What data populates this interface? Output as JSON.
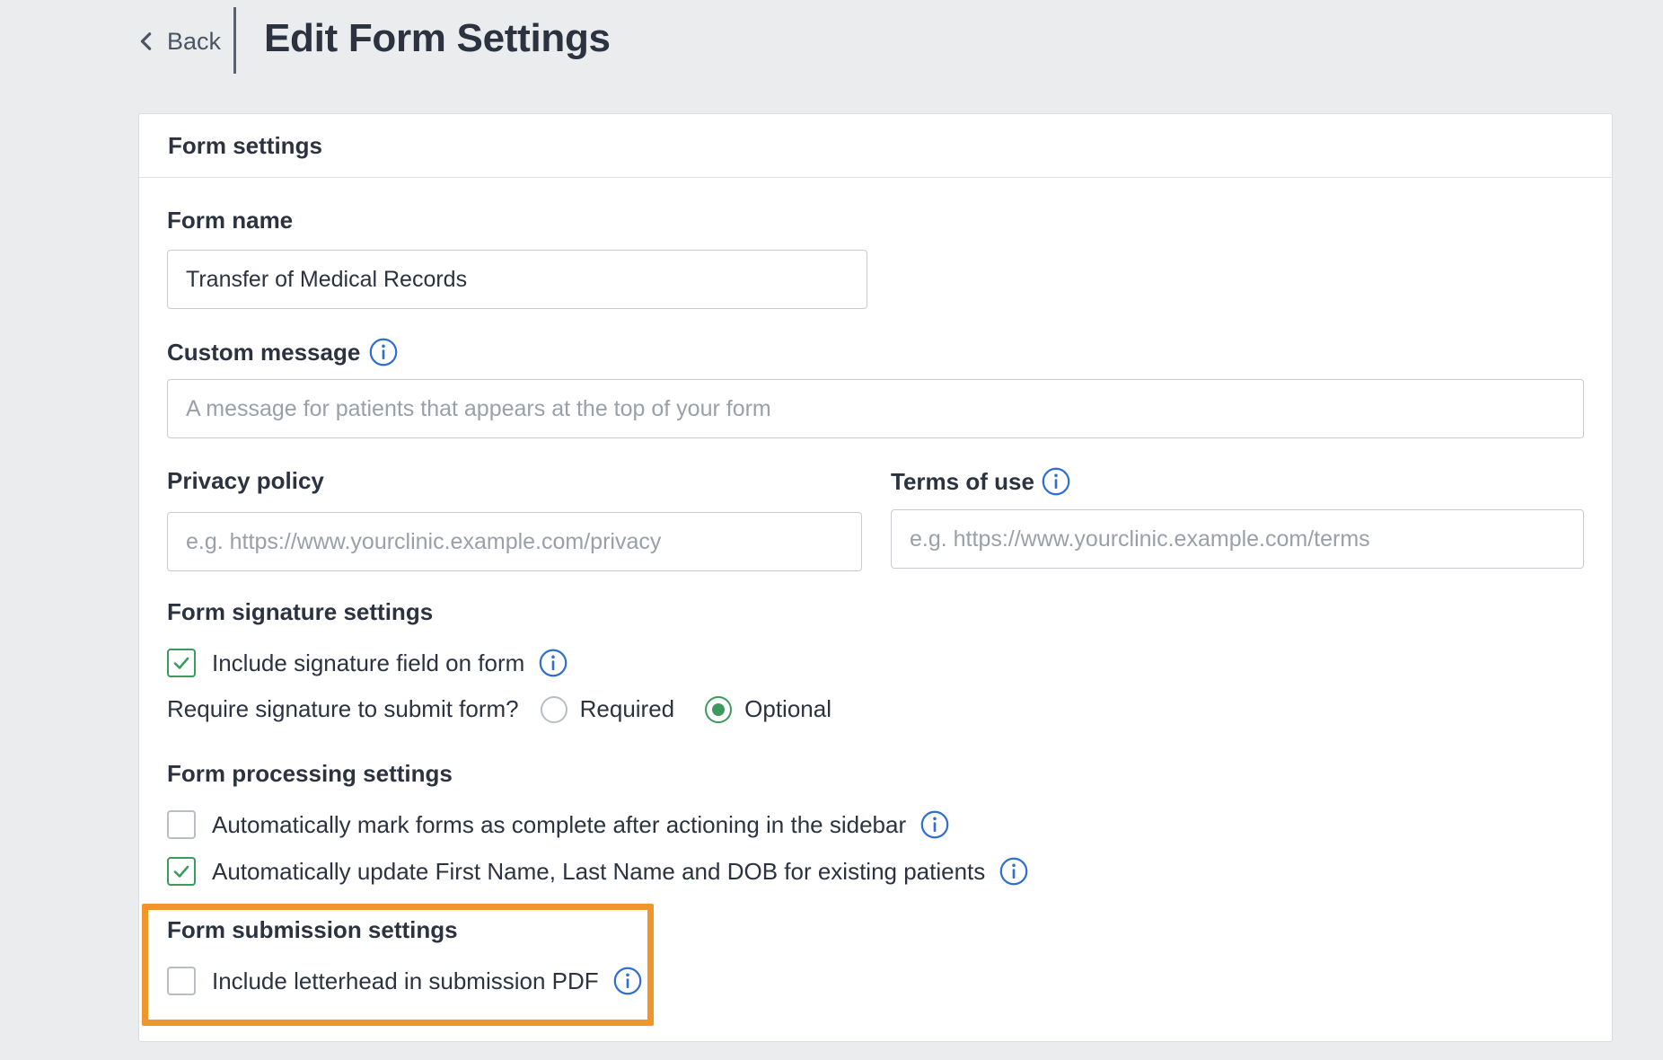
{
  "header": {
    "back_label": "Back",
    "title": "Edit Form Settings"
  },
  "card": {
    "title": "Form settings"
  },
  "form_name": {
    "label": "Form name",
    "value": "Transfer of Medical Records"
  },
  "custom_message": {
    "label": "Custom message",
    "placeholder": "A message for patients that appears at the top of your form"
  },
  "privacy_policy": {
    "label": "Privacy policy",
    "placeholder": "e.g. https://www.yourclinic.example.com/privacy"
  },
  "terms_of_use": {
    "label": "Terms of use",
    "placeholder": "e.g. https://www.yourclinic.example.com/terms"
  },
  "signature_settings": {
    "heading": "Form signature settings",
    "include_signature_label": "Include signature field on form",
    "include_signature_checked": true,
    "require_question": "Require signature to submit form?",
    "options": [
      "Required",
      "Optional"
    ],
    "selected": "Optional"
  },
  "processing_settings": {
    "heading": "Form processing settings",
    "auto_complete_label": "Automatically mark forms as complete after actioning in the sidebar",
    "auto_complete_checked": false,
    "auto_update_label": "Automatically update First Name, Last Name and DOB for existing patients",
    "auto_update_checked": true
  },
  "submission_settings": {
    "heading": "Form submission settings",
    "letterhead_label": "Include letterhead in submission PDF",
    "letterhead_checked": false
  },
  "colors": {
    "accent_green": "#3d9a5e",
    "info_blue": "#2f6fd0",
    "highlight_orange": "#f0952c"
  },
  "icons": [
    "chevron-left-icon",
    "info-icon",
    "checkmark-icon"
  ]
}
